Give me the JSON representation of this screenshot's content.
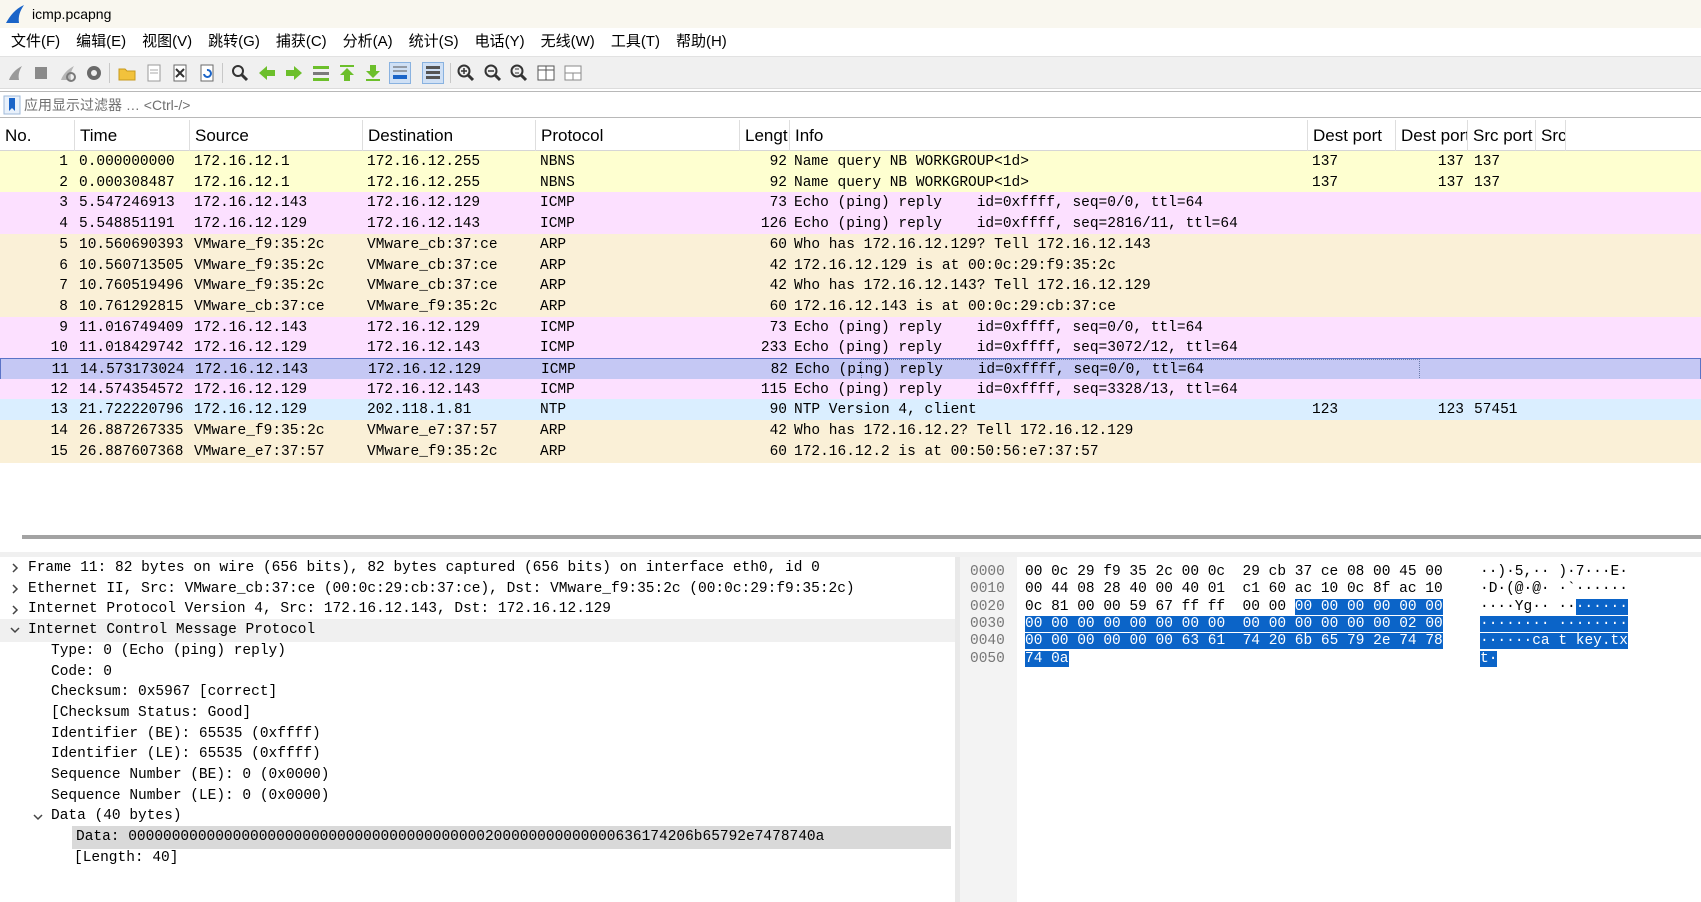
{
  "window": {
    "title": "icmp.pcapng",
    "accent": "#1a64c8"
  },
  "menu": [
    "文件(F)",
    "编辑(E)",
    "视图(V)",
    "跳转(G)",
    "捕获(C)",
    "分析(A)",
    "统计(S)",
    "电话(Y)",
    "无线(W)",
    "工具(T)",
    "帮助(H)"
  ],
  "toolbar": {
    "icons": [
      "start-capture-icon",
      "stop-capture-icon",
      "restart-capture-icon",
      "capture-options-icon",
      "open-file-icon",
      "save-file-icon",
      "close-file-icon",
      "reload-file-icon",
      "find-packet-icon",
      "go-back-icon",
      "go-forward-icon",
      "go-to-packet-icon",
      "first-packet-icon",
      "last-packet-icon",
      "autoscroll-icon",
      "colorize-icon",
      "zoom-in-icon",
      "zoom-out-icon",
      "normal-size-icon",
      "resize-columns-icon",
      "layout-icon"
    ]
  },
  "filter": {
    "placeholder": "应用显示过滤器 … <Ctrl-/>"
  },
  "packet_list": {
    "columns": [
      "No.",
      "Time",
      "Source",
      "Destination",
      "Protocol",
      "Lengt",
      "Info",
      "Dest port",
      "Dest port",
      "Src port",
      "Src"
    ],
    "rows": [
      {
        "no": "1",
        "time": "0.000000000",
        "src": "172.16.12.1",
        "dst": "172.16.12.255",
        "proto": "NBNS",
        "len": "92",
        "info": "Name query NB WORKGROUP<1d>",
        "dport": "137",
        "dport2": "137",
        "sport": "137",
        "color": "nbns"
      },
      {
        "no": "2",
        "time": "0.000308487",
        "src": "172.16.12.1",
        "dst": "172.16.12.255",
        "proto": "NBNS",
        "len": "92",
        "info": "Name query NB WORKGROUP<1d>",
        "dport": "137",
        "dport2": "137",
        "sport": "137",
        "color": "nbns"
      },
      {
        "no": "3",
        "time": "5.547246913",
        "src": "172.16.12.143",
        "dst": "172.16.12.129",
        "proto": "ICMP",
        "len": "73",
        "info": "Echo (ping) reply    id=0xffff, seq=0/0, ttl=64",
        "dport": "",
        "dport2": "",
        "sport": "",
        "color": "icmp"
      },
      {
        "no": "4",
        "time": "5.548851191",
        "src": "172.16.12.129",
        "dst": "172.16.12.143",
        "proto": "ICMP",
        "len": "126",
        "info": "Echo (ping) reply    id=0xffff, seq=2816/11, ttl=64",
        "dport": "",
        "dport2": "",
        "sport": "",
        "color": "icmp"
      },
      {
        "no": "5",
        "time": "10.560690393",
        "src": "VMware_f9:35:2c",
        "dst": "VMware_cb:37:ce",
        "proto": "ARP",
        "len": "60",
        "info": "Who has 172.16.12.129? Tell 172.16.12.143",
        "dport": "",
        "dport2": "",
        "sport": "",
        "color": "arp"
      },
      {
        "no": "6",
        "time": "10.560713505",
        "src": "VMware_f9:35:2c",
        "dst": "VMware_cb:37:ce",
        "proto": "ARP",
        "len": "42",
        "info": "172.16.12.129 is at 00:0c:29:f9:35:2c",
        "dport": "",
        "dport2": "",
        "sport": "",
        "color": "arp"
      },
      {
        "no": "7",
        "time": "10.760519496",
        "src": "VMware_f9:35:2c",
        "dst": "VMware_cb:37:ce",
        "proto": "ARP",
        "len": "42",
        "info": "Who has 172.16.12.143? Tell 172.16.12.129",
        "dport": "",
        "dport2": "",
        "sport": "",
        "color": "arp"
      },
      {
        "no": "8",
        "time": "10.761292815",
        "src": "VMware_cb:37:ce",
        "dst": "VMware_f9:35:2c",
        "proto": "ARP",
        "len": "60",
        "info": "172.16.12.143 is at 00:0c:29:cb:37:ce",
        "dport": "",
        "dport2": "",
        "sport": "",
        "color": "arp"
      },
      {
        "no": "9",
        "time": "11.016749409",
        "src": "172.16.12.143",
        "dst": "172.16.12.129",
        "proto": "ICMP",
        "len": "73",
        "info": "Echo (ping) reply    id=0xffff, seq=0/0, ttl=64",
        "dport": "",
        "dport2": "",
        "sport": "",
        "color": "icmp"
      },
      {
        "no": "10",
        "time": "11.018429742",
        "src": "172.16.12.129",
        "dst": "172.16.12.143",
        "proto": "ICMP",
        "len": "233",
        "info": "Echo (ping) reply    id=0xffff, seq=3072/12, ttl=64",
        "dport": "",
        "dport2": "",
        "sport": "",
        "color": "icmp"
      },
      {
        "no": "11",
        "time": "14.573173024",
        "src": "172.16.12.143",
        "dst": "172.16.12.129",
        "proto": "ICMP",
        "len": "82",
        "info": "Echo (ping) reply    id=0xffff, seq=0/0, ttl=64",
        "dport": "",
        "dport2": "",
        "sport": "",
        "color": "sel"
      },
      {
        "no": "12",
        "time": "14.574354572",
        "src": "172.16.12.129",
        "dst": "172.16.12.143",
        "proto": "ICMP",
        "len": "115",
        "info": "Echo (ping) reply    id=0xffff, seq=3328/13, ttl=64",
        "dport": "",
        "dport2": "",
        "sport": "",
        "color": "icmp"
      },
      {
        "no": "13",
        "time": "21.722220796",
        "src": "172.16.12.129",
        "dst": "202.118.1.81",
        "proto": "NTP",
        "len": "90",
        "info": "NTP Version 4, client",
        "dport": "123",
        "dport2": "123",
        "sport": "57451",
        "color": "ntp"
      },
      {
        "no": "14",
        "time": "26.887267335",
        "src": "VMware_f9:35:2c",
        "dst": "VMware_e7:37:57",
        "proto": "ARP",
        "len": "42",
        "info": "Who has 172.16.12.2? Tell 172.16.12.129",
        "dport": "",
        "dport2": "",
        "sport": "",
        "color": "arp"
      },
      {
        "no": "15",
        "time": "26.887607368",
        "src": "VMware_e7:37:57",
        "dst": "VMware_f9:35:2c",
        "proto": "ARP",
        "len": "60",
        "info": "172.16.12.2 is at 00:50:56:e7:37:57",
        "dport": "",
        "dport2": "",
        "sport": "",
        "color": "arp"
      }
    ]
  },
  "details": [
    {
      "text": "Frame 11: 82 bytes on wire (656 bits), 82 bytes captured (656 bits) on interface eth0, id 0",
      "level": 0,
      "arrow": "collapsed"
    },
    {
      "text": "Ethernet II, Src: VMware_cb:37:ce (00:0c:29:cb:37:ce), Dst: VMware_f9:35:2c (00:0c:29:f9:35:2c)",
      "level": 0,
      "arrow": "collapsed"
    },
    {
      "text": "Internet Protocol Version 4, Src: 172.16.12.143, Dst: 172.16.12.129",
      "level": 0,
      "arrow": "collapsed"
    },
    {
      "text": "Internet Control Message Protocol",
      "level": 0,
      "arrow": "expanded"
    },
    {
      "text": "Type: 0 (Echo (ping) reply)",
      "level": 1,
      "arrow": "none"
    },
    {
      "text": "Code: 0",
      "level": 1,
      "arrow": "none"
    },
    {
      "text": "Checksum: 0x5967 [correct]",
      "level": 1,
      "arrow": "none"
    },
    {
      "text": "[Checksum Status: Good]",
      "level": 1,
      "arrow": "none"
    },
    {
      "text": "Identifier (BE): 65535 (0xffff)",
      "level": 1,
      "arrow": "none"
    },
    {
      "text": "Identifier (LE): 65535 (0xffff)",
      "level": 1,
      "arrow": "none"
    },
    {
      "text": "Sequence Number (BE): 0 (0x0000)",
      "level": 1,
      "arrow": "none"
    },
    {
      "text": "Sequence Number (LE): 0 (0x0000)",
      "level": 1,
      "arrow": "none"
    },
    {
      "text": "Data (40 bytes)",
      "level": 1,
      "arrow": "expanded"
    },
    {
      "text": "Data: 00000000000000000000000000000000000000000200000000000000636174206b65792e7478740a",
      "level": 2,
      "arrow": "none"
    },
    {
      "text": "[Length: 40]",
      "level": 2,
      "arrow": "none"
    }
  ],
  "hex": [
    {
      "off": "0000",
      "hex": "00 0c 29 f9 35 2c 00 0c  29 cb 37 ce 08 00 45 00",
      "ascii": "··)·5,·· )·7···E·",
      "sel_from": 0
    },
    {
      "off": "0010",
      "hex": "00 44 08 28 40 00 40 01  c1 60 ac 10 0c 8f ac 10",
      "ascii": "·D·(@·@· ·`······",
      "sel_from": 0
    },
    {
      "off": "0020",
      "hex": "0c 81 00 00 59 67 ff ff  00 00 00 00 00 00 00 00",
      "ascii": "····Yg·· ········",
      "sel_from": 10
    },
    {
      "off": "0030",
      "hex": "00 00 00 00 00 00 00 00  00 00 00 00 00 00 02 00",
      "ascii": "········ ········",
      "sel_from": 0
    },
    {
      "off": "0040",
      "hex": "00 00 00 00 00 00 63 61  74 20 6b 65 79 2e 74 78",
      "ascii": "······ca t key.tx",
      "sel_from": 0
    },
    {
      "off": "0050",
      "hex": "74 0a",
      "ascii": "t·",
      "sel_from": 0
    }
  ]
}
